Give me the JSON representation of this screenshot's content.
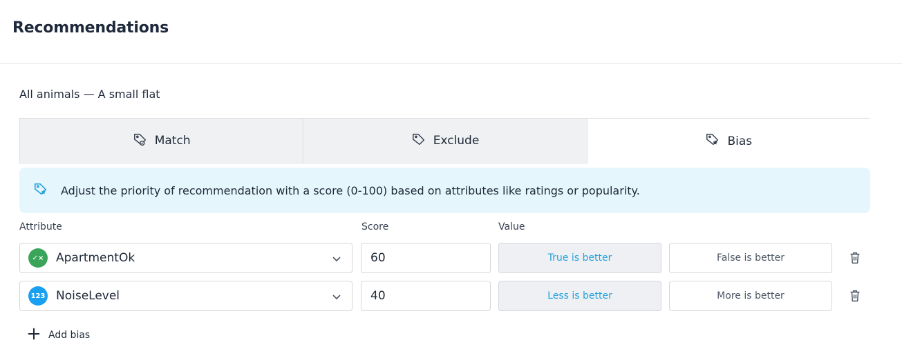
{
  "header": {
    "title": "Recommendations"
  },
  "subtitle": "All animals — A small flat",
  "tabs": [
    {
      "label": "Match",
      "icon": "tag-check-icon",
      "active": false
    },
    {
      "label": "Exclude",
      "icon": "tag-icon",
      "active": false
    },
    {
      "label": "Bias",
      "icon": "tag-star-icon",
      "active": true
    }
  ],
  "info": {
    "icon": "tag-star-icon",
    "text": "Adjust the priority of recommendation with a score (0-100) based on attributes like ratings or popularity."
  },
  "columns": {
    "attribute": "Attribute",
    "score": "Score",
    "value": "Value"
  },
  "rows": [
    {
      "attribute": "ApartmentOk",
      "badge": "✓×",
      "badge_color": "#3aa55a",
      "score": "60",
      "option_a": "True is better",
      "option_b": "False is better",
      "selected": "option_a"
    },
    {
      "attribute": "NoiseLevel",
      "badge": "123",
      "badge_color": "#1aa0f0",
      "score": "40",
      "option_a": "Less is better",
      "option_b": "More is better",
      "selected": "option_a"
    }
  ],
  "add_bias": {
    "label": "Add bias"
  },
  "colors": {
    "accent": "#23a3dc",
    "banner_bg": "#e6f6fd",
    "tab_inactive_bg": "#f0f1f3"
  }
}
